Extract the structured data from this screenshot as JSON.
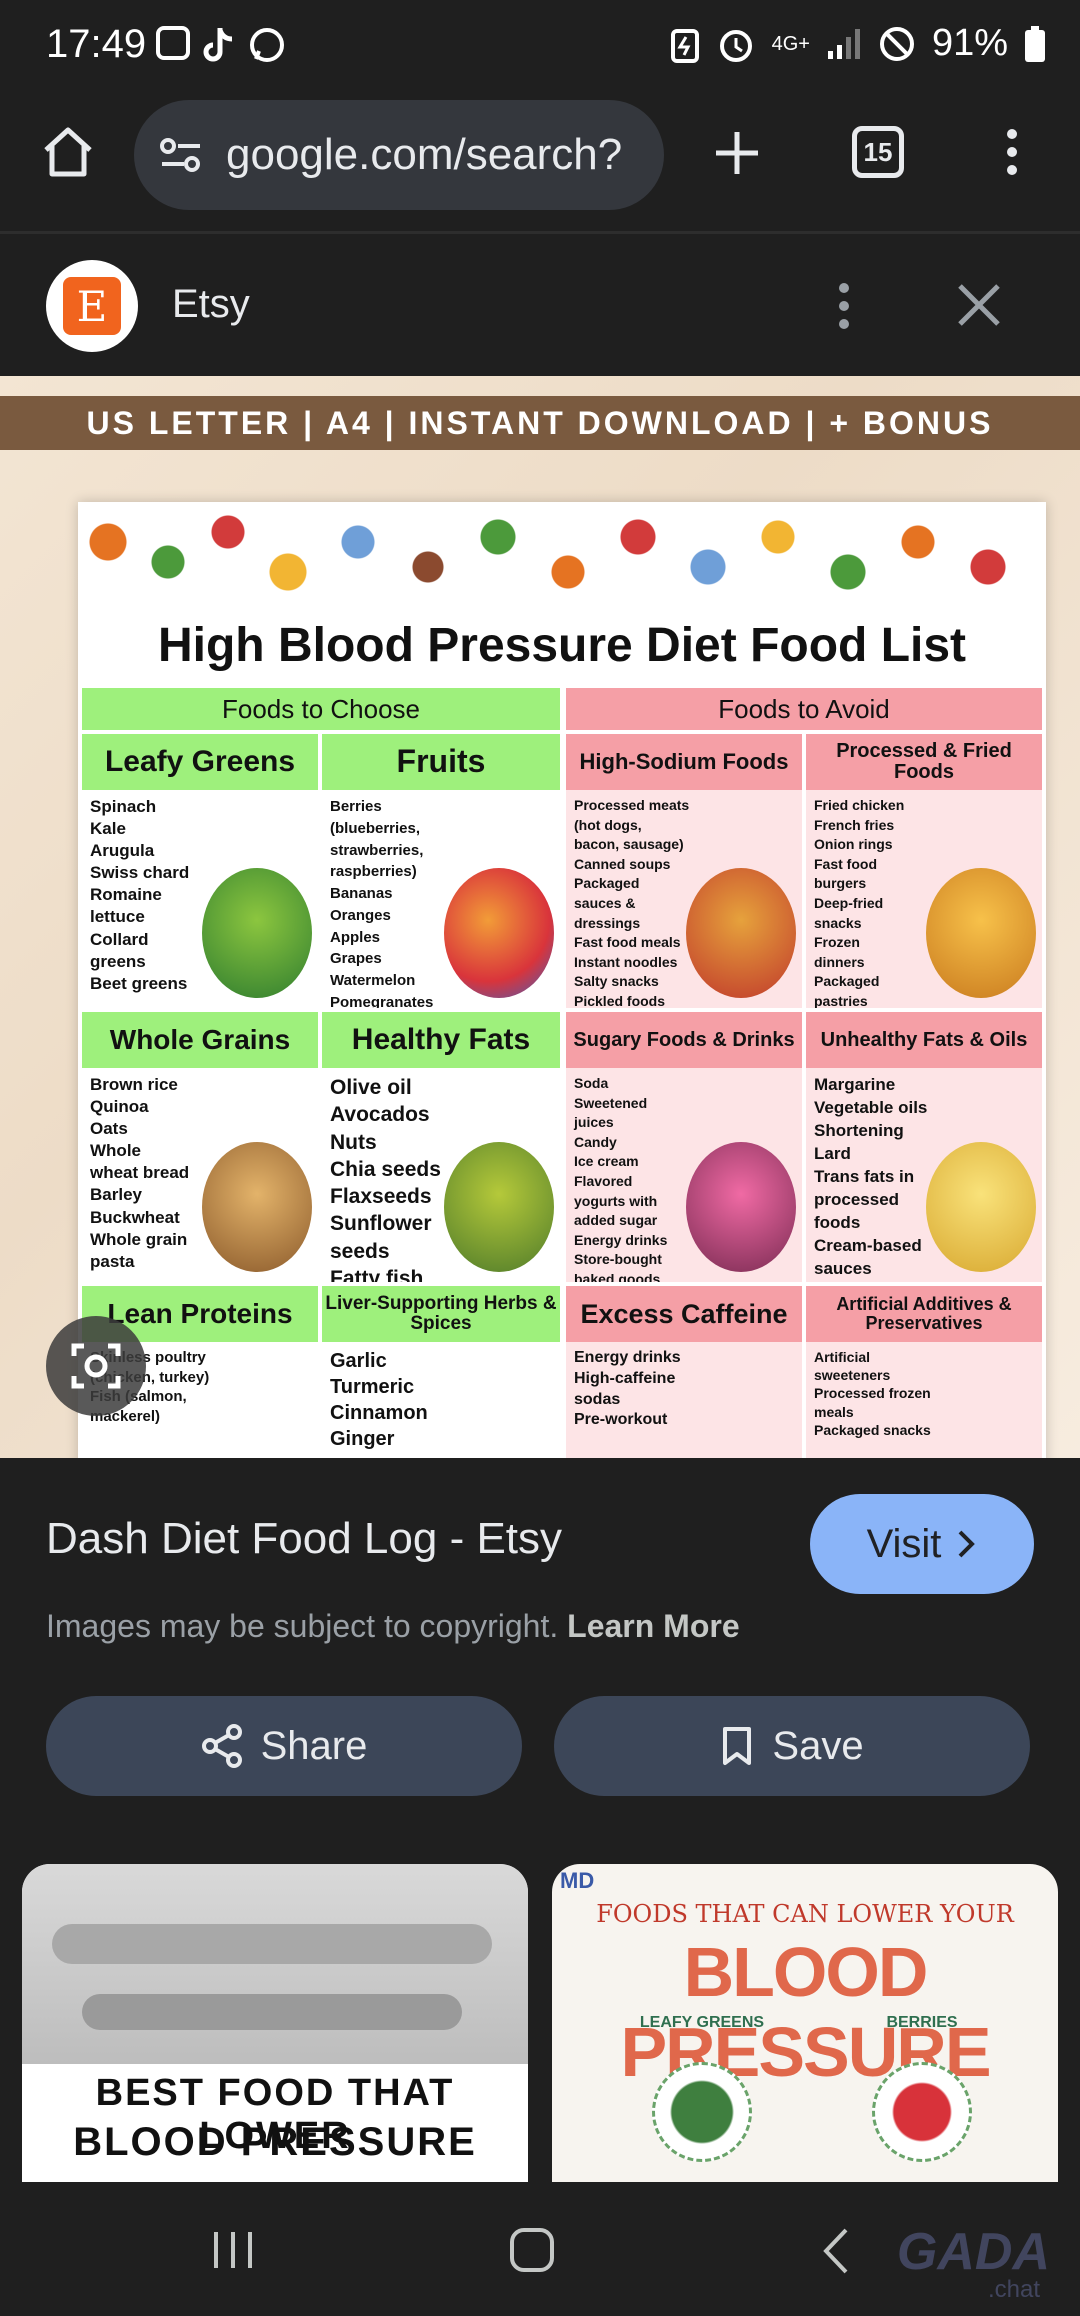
{
  "status_bar": {
    "time": "17:49",
    "battery": "91%",
    "network": "4G+"
  },
  "browser": {
    "url": "google.com/search?",
    "tab_count": "15",
    "icons": [
      "home-icon",
      "site-settings-icon",
      "new-tab-icon",
      "tab-switcher-icon",
      "more-vert-icon"
    ]
  },
  "source": {
    "name": "Etsy",
    "logo_letter": "E"
  },
  "preview": {
    "banner": "US LETTER | A4 | INSTANT DOWNLOAD | + BONUS",
    "title": "High Blood Pressure Diet Food List",
    "choose_header": "Foods to Choose",
    "avoid_header": "Foods to Avoid",
    "sections": [
      {
        "title": "Leafy Greens",
        "items": "Spinach\nKale\nArugula\nSwiss chard\nRomaine\nlettuce\nCollard\ngreens\nBeet greens"
      },
      {
        "title": "Fruits",
        "items": "Berries\n(blueberries,\nstrawberries,\nraspberries)\nBananas\nOranges\nApples\nGrapes\nWatermelon\nPomegranates"
      },
      {
        "title": "High-Sodium Foods",
        "items": "Processed meats\n(hot dogs,\nbacon, sausage)\nCanned soups\nPackaged\nsauces &\ndressings\nFast food meals\nInstant noodles\nSalty snacks\nPickled foods"
      },
      {
        "title": "Processed & Fried Foods",
        "items": "Fried chicken\nFrench fries\nOnion rings\nFast food\nburgers\nDeep-fried\nsnacks\nFrozen\ndinners\nPackaged\npastries"
      },
      {
        "title": "Whole Grains",
        "items": "Brown rice\nQuinoa\nOats\nWhole\nwheat bread\nBarley\nBuckwheat\nWhole grain\npasta"
      },
      {
        "title": "Healthy Fats",
        "items": "Olive oil\nAvocados\nNuts\nChia seeds\nFlaxseeds\nSunflower\nseeds\nFatty fish"
      },
      {
        "title": "Sugary Foods & Drinks",
        "items": "Soda\nSweetened\njuices\nCandy\nIce cream\nFlavored\nyogurts with\nadded sugar\nEnergy drinks\nStore-bought\nbaked goods"
      },
      {
        "title": "Unhealthy Fats & Oils",
        "items": "Margarine\nVegetable oils\nShortening Lard\nTrans fats in\nprocessed\nfoods\nCream-based\nsauces\nHigh-fat dairy"
      },
      {
        "title": "Lean Proteins",
        "items": "Skinless poultry\n(chicken, turkey)\nFish (salmon,\nmackerel)"
      },
      {
        "title": "Liver-Supporting Herbs & Spices",
        "items": "Garlic\nTurmeric\nCinnamon\nGinger"
      },
      {
        "title": "Excess Caffeine",
        "items": "Energy drinks\nHigh-caffeine\nsodas\nPre-workout"
      },
      {
        "title": "Artificial Additives & Preservatives",
        "items": "Artificial\nsweeteners\nProcessed frozen\nmeals\nPackaged snacks"
      }
    ]
  },
  "result": {
    "title": "Dash Diet Food Log - Etsy",
    "visit_label": "Visit",
    "copyright_text": "Images may be subject to copyright.",
    "learn_more": "Learn More",
    "share_label": "Share",
    "save_label": "Save"
  },
  "related": [
    {
      "line1": "BEST FOOD THAT LOWER",
      "line2": "BLOOD PRESSURE"
    },
    {
      "watermark": "MD",
      "line1": "FOODS THAT CAN LOWER YOUR",
      "line2": "BLOOD PRESSURE",
      "col1": "LEAFY GREENS",
      "col2": "BERRIES"
    }
  ],
  "watermark": {
    "main": "GADA",
    "sub": ".chat"
  }
}
